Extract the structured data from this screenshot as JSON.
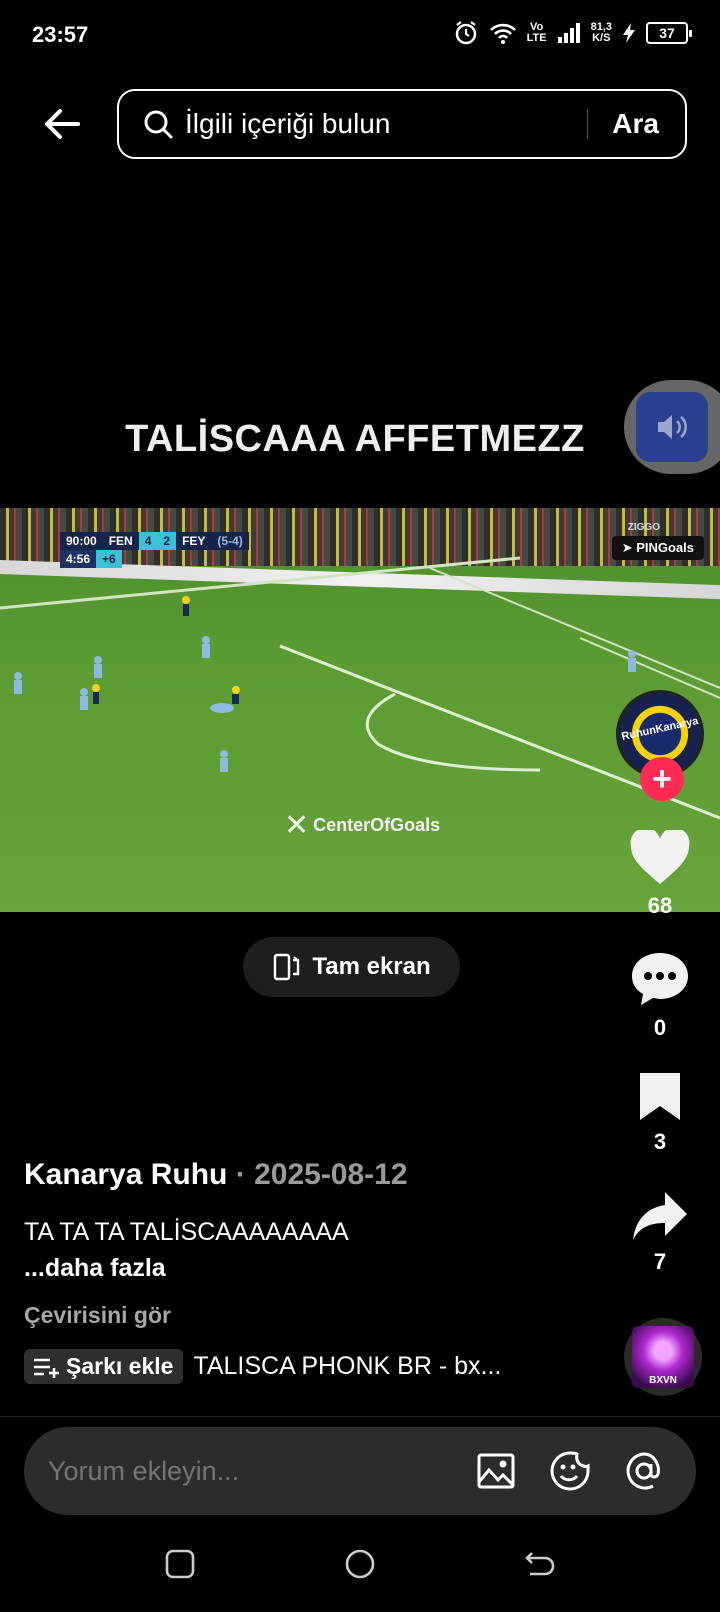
{
  "status_bar": {
    "time": "23:57",
    "network_label_top": "Vo",
    "network_label_bottom": "LTE",
    "speed_top": "81,3",
    "speed_bottom": "K/S",
    "battery": "37"
  },
  "search": {
    "placeholder": "İlgili içeriği bulun",
    "button": "Ara"
  },
  "video": {
    "overlay_title": "TALİSCAAA AFFETMEZZ",
    "scoreboard": {
      "clock": "90:00",
      "home": "FEN",
      "home_score": "4",
      "away_score": "2",
      "away": "FEY",
      "aggregate": "(5-4)",
      "added_time": "4:56",
      "added_plus": "+6"
    },
    "watermark": "CenterOfGoals",
    "channel_tag": "PINGoals",
    "broadcaster": "ZIGGO",
    "fullscreen_label": "Tam ekran"
  },
  "actions": {
    "avatar_label": "RuhunKanarya",
    "likes": "68",
    "comments": "0",
    "saves": "3",
    "shares": "7"
  },
  "post": {
    "author": "Kanarya Ruhu",
    "separator": "·",
    "date": "2025-08-12",
    "caption": "TA TA TA TALİSCAAAAAAAA",
    "more": "...daha fazla",
    "translate": "Çevirisini gör",
    "add_song": "Şarkı ekle",
    "song": "TALISCA PHONK BR - bx...",
    "disc_label": "BXVN"
  },
  "comment": {
    "placeholder": "Yorum ekleyin..."
  },
  "colors": {
    "accent": "#fe2c55",
    "mute_button": "#2a3f8f",
    "pitch": "#5c9c33"
  }
}
